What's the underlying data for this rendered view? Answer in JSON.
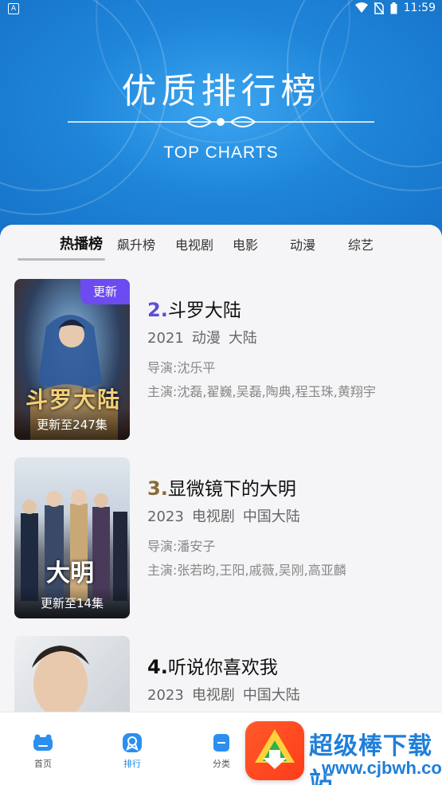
{
  "status_bar": {
    "time": "11:59",
    "left_icon": "A",
    "icons": [
      "wifi-icon",
      "sim-off-icon",
      "battery-icon"
    ]
  },
  "hero": {
    "title": "优质排行榜",
    "subtitle": "TOP CHARTS"
  },
  "tabs": [
    {
      "label": "热播榜",
      "active": true
    },
    {
      "label": "飙升榜",
      "active": false
    },
    {
      "label": "电视剧",
      "active": false
    },
    {
      "label": "电影",
      "active": false
    },
    {
      "label": "动漫",
      "active": false
    },
    {
      "label": "综艺",
      "active": false
    }
  ],
  "items": [
    {
      "rank": "2.",
      "rank_color": "#5a4fd8",
      "title": "斗罗大陆",
      "year": "2021",
      "genre": "动漫",
      "region": "大陆",
      "director_label": "导演:",
      "director": "沈乐平",
      "actors_label": "主演:",
      "actors": "沈磊,翟巍,吴磊,陶典,程玉珠,黄翔宇",
      "badge": "更新",
      "poster_caption": "更新至247集",
      "poster_text": "斗罗大陆"
    },
    {
      "rank": "3.",
      "rank_color": "#8a6a3a",
      "title": "显微镜下的大明",
      "year": "2023",
      "genre": "电视剧",
      "region": "中国大陆",
      "director_label": "导演:",
      "director": "潘安子",
      "actors_label": "主演:",
      "actors": "张若昀,王阳,戚薇,吴刚,高亚麟",
      "poster_caption": "更新至14集",
      "poster_text": "大明"
    },
    {
      "rank": "4.",
      "rank_color": "#111111",
      "title": "听说你喜欢我",
      "year": "2023",
      "genre": "电视剧",
      "region": "中国大陆"
    }
  ],
  "bottom_nav": [
    {
      "label": "首页",
      "icon": "home-icon",
      "active": false
    },
    {
      "label": "排行",
      "icon": "ranking-icon",
      "active": true
    },
    {
      "label": "分类",
      "icon": "category-icon",
      "active": false
    }
  ],
  "watermark": {
    "text": "超级棒下载站",
    "url": "www.cjbwh.com"
  },
  "colors": {
    "accent": "#1a8ae6",
    "badge": "#6c4cf0"
  }
}
